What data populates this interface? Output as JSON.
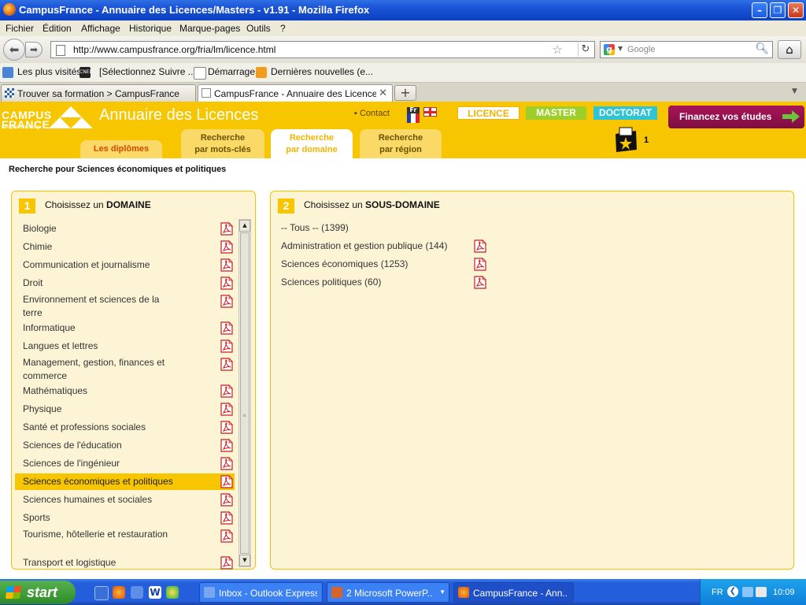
{
  "window": {
    "title": "CampusFrance - Annuaire des Licences/Masters - v1.91 - Mozilla Firefox"
  },
  "menu": [
    "Fichier",
    "Édition",
    "Affichage",
    "Historique",
    "Marque-pages",
    "Outils",
    "?"
  ],
  "nav": {
    "url": "http://www.campusfrance.org/fria/lm/licence.html",
    "search_placeholder": "Google"
  },
  "bookmarks": [
    "Les plus visités",
    "[Sélectionnez Suivre ...",
    "Démarrage",
    "Dernières nouvelles (e..."
  ],
  "tabs": [
    {
      "label": "Trouver sa formation > CampusFrance",
      "active": false
    },
    {
      "label": "CampusFrance - Annuaire des Licences/...",
      "active": true
    }
  ],
  "site": {
    "logo_line1": "CAMPUS",
    "logo_line2": "FRANCE",
    "logo_url": "campusfrance.org",
    "title": "Annuaire des Licences",
    "contact": "Contact",
    "flag_fr_label": "Fr",
    "levels": [
      "LICENCE",
      "MASTER",
      "DOCTORAT"
    ],
    "finance": "Financez vos études",
    "tabs": [
      {
        "line1": "Les diplômes",
        "line2": ""
      },
      {
        "line1": "Recherche",
        "line2": "par mots-clés"
      },
      {
        "line1": "Recherche",
        "line2": "par domaine"
      },
      {
        "line1": "Recherche",
        "line2": "par région"
      }
    ],
    "cart_count": "1"
  },
  "page": {
    "search_for": "Recherche pour Sciences économiques et politiques",
    "panel1": {
      "number": "1",
      "title_prefix": "Choisissez un",
      "title_bold": "DOMAINE",
      "items": [
        "Biologie",
        "Chimie",
        "Communication et journalisme",
        "Droit",
        "Environnement et sciences de la terre",
        "Informatique",
        "Langues et lettres",
        "Management, gestion, finances et commerce",
        "Mathématiques",
        "Physique",
        "Santé et professions sociales",
        "Sciences de l'éducation",
        "Sciences de l'ingénieur",
        "Sciences économiques et politiques",
        "Sciences humaines et sociales",
        "Sports",
        "Tourisme, hôtellerie et restauration",
        "Transport et logistique"
      ],
      "selected": "Sciences économiques et politiques"
    },
    "panel2": {
      "number": "2",
      "title_prefix": "Choisissez un",
      "title_bold": "SOUS-DOMAINE",
      "items": [
        {
          "label": "-- Tous -- (1399)",
          "pdf": false
        },
        {
          "label": "Administration et gestion publique (144)",
          "pdf": true
        },
        {
          "label": "Sciences économiques (1253)",
          "pdf": true
        },
        {
          "label": "Sciences politiques (60)",
          "pdf": true
        }
      ]
    }
  },
  "taskbar": {
    "start": "start",
    "tasks": [
      {
        "label": "Inbox - Outlook Express",
        "active": false
      },
      {
        "label": "2 Microsoft PowerP...",
        "active": false
      },
      {
        "label": "CampusFrance - Ann...",
        "active": true
      }
    ],
    "lang": "FR",
    "clock": "10:09"
  }
}
